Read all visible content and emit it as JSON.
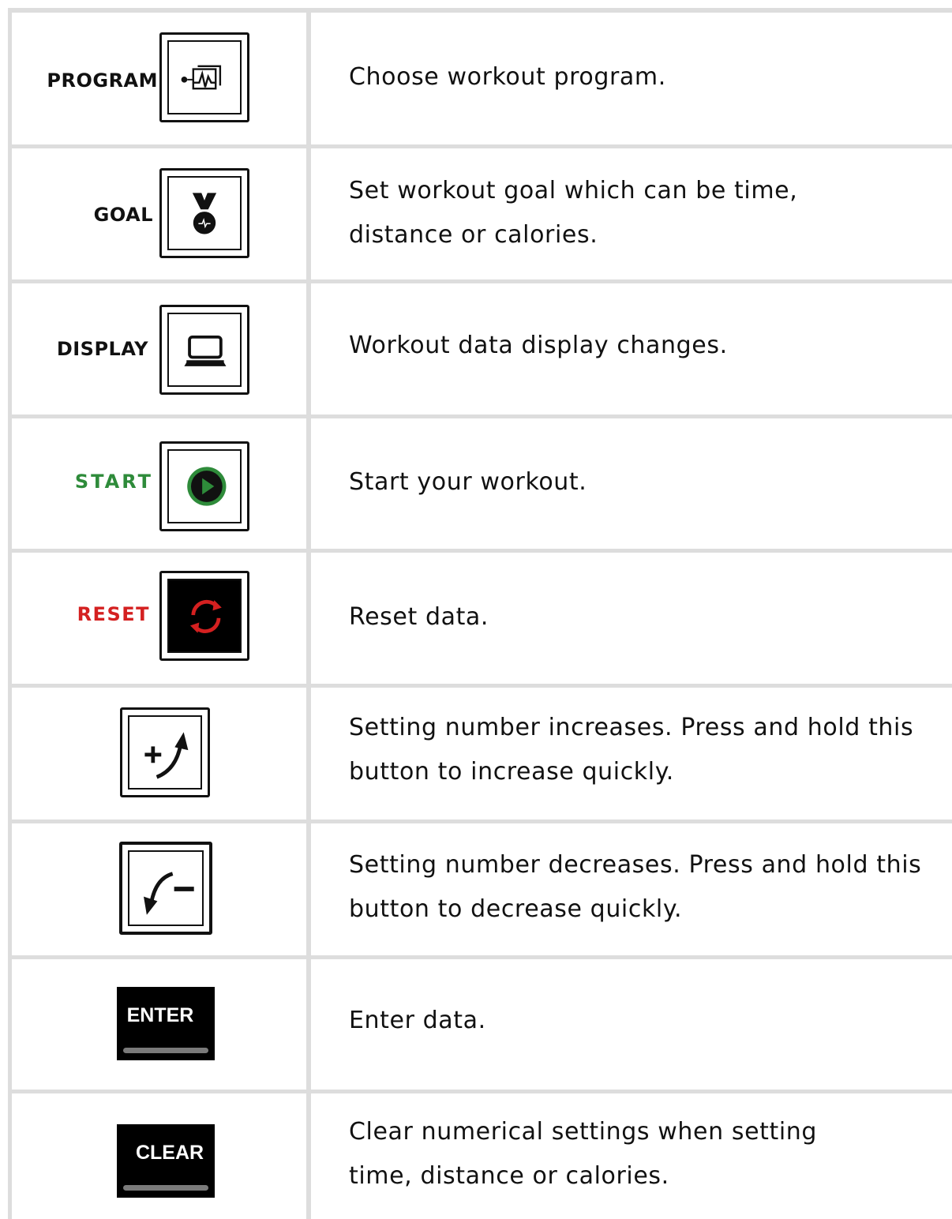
{
  "rows": [
    {
      "label": "PROGRAM",
      "icon": "program-icon",
      "text": "Choose workout program."
    },
    {
      "label": "GOAL",
      "icon": "medal-icon",
      "text": "Set workout goal which can be time, distance or calories."
    },
    {
      "label": "DISPLAY",
      "icon": "laptop-icon",
      "text": "Workout data display changes."
    },
    {
      "label": "START",
      "icon": "play-icon",
      "text": "Start your workout.",
      "label_color": "#2e8b3a"
    },
    {
      "label": "RESET",
      "icon": "refresh-icon",
      "text": "Reset data.",
      "label_color": "#d42020"
    },
    {
      "label": "",
      "icon": "increase-icon",
      "text": "Setting number increases. Press and hold this button to increase quickly."
    },
    {
      "label": "",
      "icon": "decrease-icon",
      "text": "Setting number decreases. Press and hold this button to decrease quickly."
    },
    {
      "label": "ENTER",
      "icon": "enter-key",
      "text": "Enter data."
    },
    {
      "label": "CLEAR",
      "icon": "clear-key",
      "text": "Clear numerical settings when setting time, distance or calories."
    }
  ],
  "colors": {
    "start": "#2e8b3a",
    "reset": "#d42020",
    "grid": "#dddddd"
  }
}
